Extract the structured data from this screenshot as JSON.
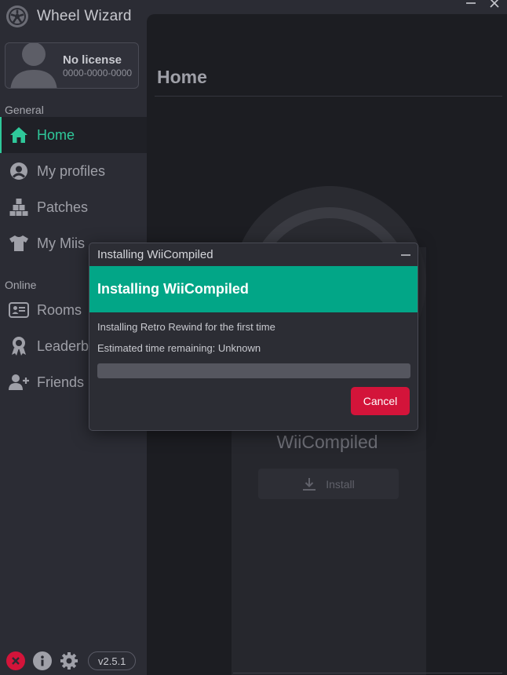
{
  "app": {
    "title": "Wheel Wizard",
    "version": "v2.5.1"
  },
  "user": {
    "name": "No license",
    "friend_code": "0000-0000-0000"
  },
  "sidebar": {
    "sections": {
      "general": "General",
      "online": "Online"
    },
    "items": [
      {
        "label": "Home",
        "icon": "home-icon",
        "active": true
      },
      {
        "label": "My profiles",
        "icon": "user-circle-icon"
      },
      {
        "label": "Patches",
        "icon": "cubes-icon"
      },
      {
        "label": "My Miis",
        "icon": "shirt-icon"
      },
      {
        "label": "Rooms",
        "icon": "rooms-icon"
      },
      {
        "label": "Leaderb",
        "icon": "award-icon"
      },
      {
        "label": "Friends",
        "icon": "add-friend-icon"
      }
    ]
  },
  "main": {
    "title": "Home",
    "mod_title": "WiiCompiled",
    "install_label": "Install"
  },
  "dialog": {
    "window_title": "Installing WiiCompiled",
    "header": "Installing WiiCompiled",
    "status": "Installing Retro Rewind for the first time",
    "eta": "Estimated time remaining: Unknown",
    "progress": 0,
    "cancel_label": "Cancel"
  },
  "colors": {
    "accent": "#02a687",
    "active_nav": "#2fc89a",
    "danger": "#d3143a",
    "background": "#2b2c34",
    "panel": "#1c1d22"
  }
}
